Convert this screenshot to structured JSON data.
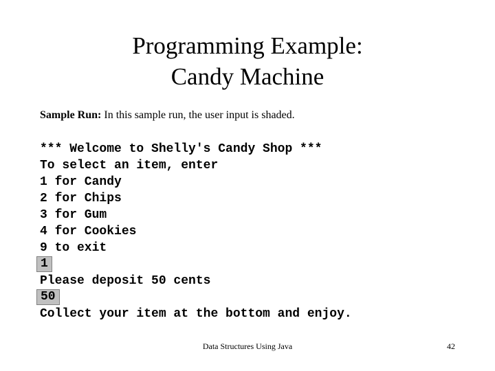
{
  "slide": {
    "title_lines": [
      "Programming Example:",
      "Candy Machine"
    ],
    "caption": {
      "lead": "Sample Run:",
      "rest": " In this sample run, the user input is shaded."
    },
    "console_lines": [
      {
        "type": "output",
        "text": "*** Welcome to Shelly's Candy Shop ***"
      },
      {
        "type": "output",
        "text": "To select an item, enter"
      },
      {
        "type": "output",
        "text": "1 for Candy"
      },
      {
        "type": "output",
        "text": "2 for Chips"
      },
      {
        "type": "output",
        "text": "3 for Gum"
      },
      {
        "type": "output",
        "text": "4 for Cookies"
      },
      {
        "type": "output",
        "text": "9 to exit"
      },
      {
        "type": "input",
        "text": "1"
      },
      {
        "type": "output",
        "text": "Please deposit 50 cents"
      },
      {
        "type": "input",
        "text": "50"
      },
      {
        "type": "output",
        "text": "Collect your item at the bottom and enjoy."
      }
    ],
    "footer": {
      "book_title": "Data Structures Using Java",
      "page_number": "42"
    },
    "colors": {
      "background": "#ffffff",
      "text": "#000000",
      "input_shade_fill": "#c0c0c0",
      "input_shade_border": "#808080"
    }
  }
}
